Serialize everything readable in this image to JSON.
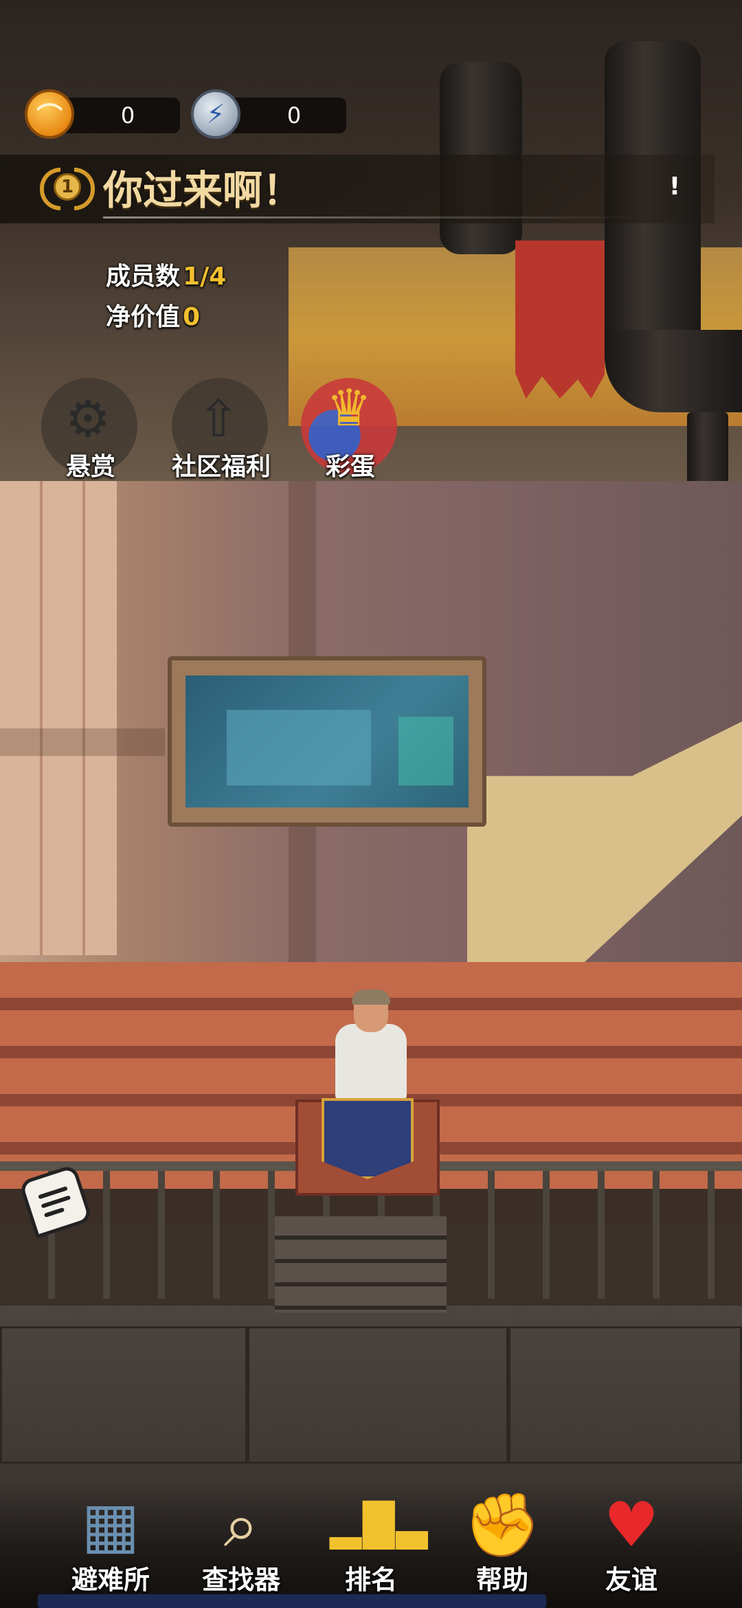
{
  "currencies": [
    {
      "name": "gold-coin",
      "value": "0",
      "glyph": "⌒"
    },
    {
      "name": "energy-coin",
      "value": "0",
      "glyph": "⚡"
    }
  ],
  "header": {
    "rank": "1",
    "title": "你过来啊！",
    "info": "!"
  },
  "stats": {
    "members_label": "成员数",
    "members_value": "1/4",
    "networth_label": "净价值",
    "networth_value": "0"
  },
  "quick_actions": [
    {
      "label": "悬赏",
      "icon": "bounty-icon"
    },
    {
      "label": "社区福利",
      "icon": "community-benefits-icon"
    },
    {
      "label": "彩蛋",
      "icon": "easter-egg-icon"
    }
  ],
  "bottom_nav": [
    {
      "label": "避难所",
      "icon": "shelter-icon"
    },
    {
      "label": "查找器",
      "icon": "finder-icon"
    },
    {
      "label": "排名",
      "icon": "ranking-icon"
    },
    {
      "label": "帮助",
      "icon": "help-handshake-icon"
    },
    {
      "label": "友谊",
      "icon": "friendship-heart-icon"
    }
  ]
}
